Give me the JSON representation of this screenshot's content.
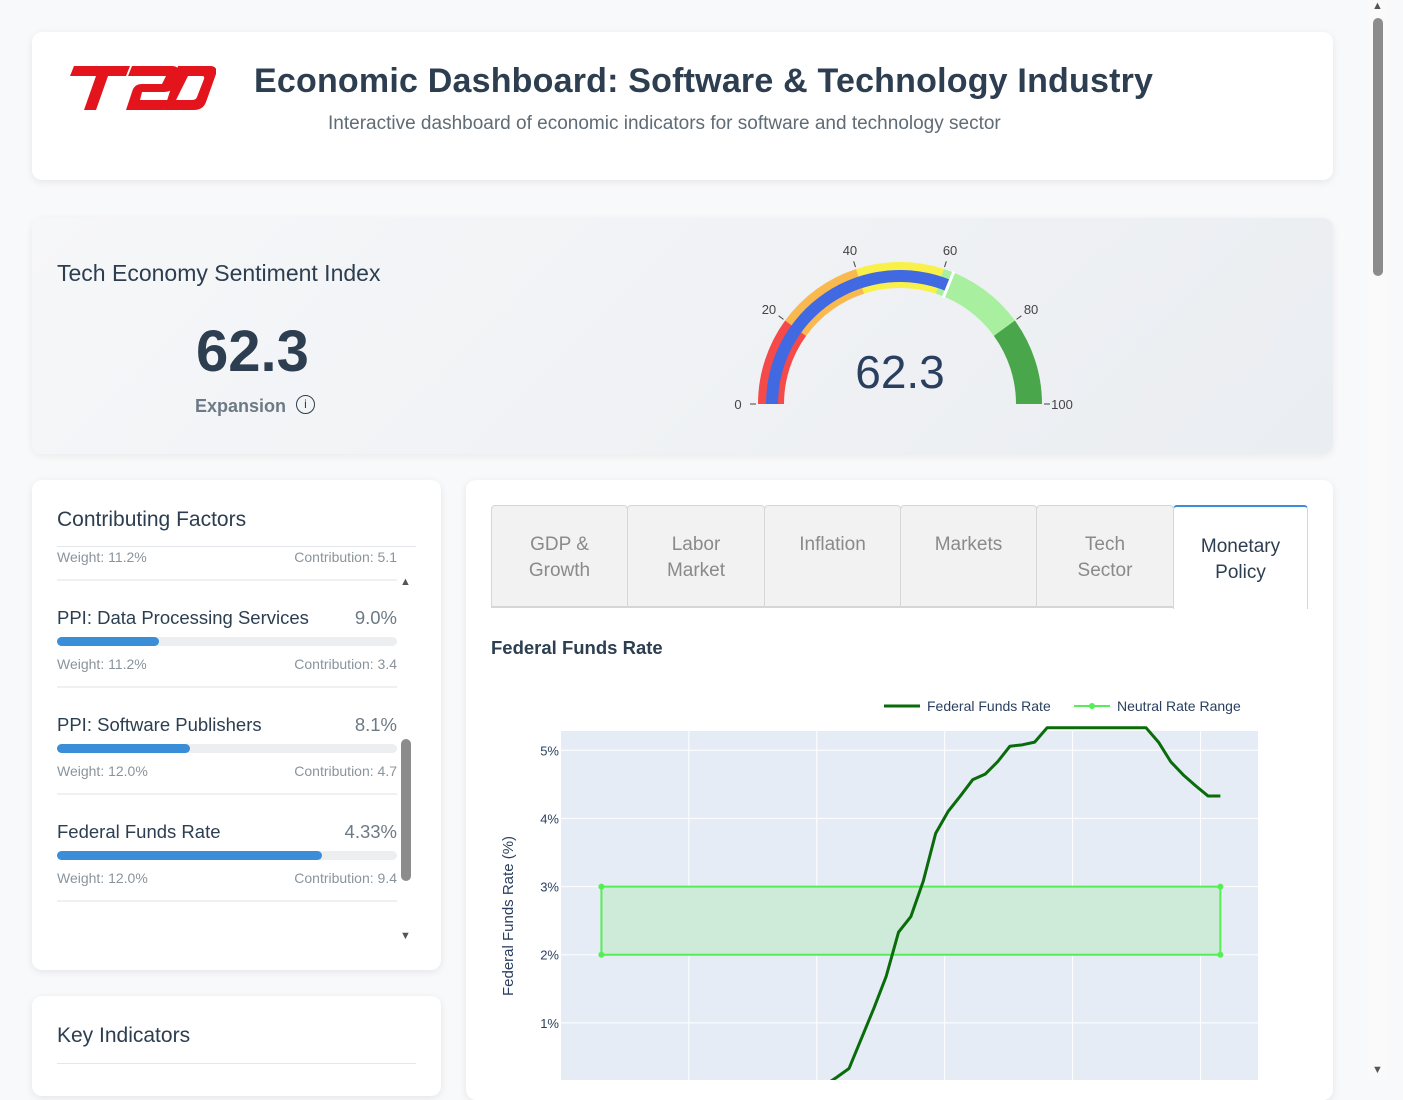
{
  "header": {
    "logo_text": "T2D",
    "title": "Economic Dashboard: Software & Technology Industry",
    "subtitle": "Interactive dashboard of economic indicators for software and technology sector"
  },
  "sentiment": {
    "title": "Tech Economy Sentiment Index",
    "value": "62.3",
    "label": "Expansion",
    "info_icon": "info-icon",
    "gauge": {
      "value": 62.3,
      "value_text": "62.3",
      "min": 0,
      "max": 100,
      "ticks": [
        "0",
        "20",
        "40",
        "60",
        "80",
        "100"
      ],
      "colors": {
        "band_0_20": "#f44a4a",
        "band_20_40": "#f9b94f",
        "band_40_60": "#f9f04a",
        "band_60_80": "#a8f0a0",
        "band_80_100": "#4aa64a",
        "value_bar": "#4169e1"
      }
    }
  },
  "factors": {
    "title": "Contributing Factors",
    "items": [
      {
        "name": "",
        "value": "",
        "weight": "Weight: 11.2%",
        "contribution": "Contribution: 5.1",
        "fill": 0
      },
      {
        "name": "PPI: Data Processing Services",
        "value": "9.0%",
        "weight": "Weight: 11.2%",
        "contribution": "Contribution: 3.4",
        "fill": 0.3
      },
      {
        "name": "PPI: Software Publishers",
        "value": "8.1%",
        "weight": "Weight: 12.0%",
        "contribution": "Contribution: 4.7",
        "fill": 0.39
      },
      {
        "name": "Federal Funds Rate",
        "value": "4.33%",
        "weight": "Weight: 12.0%",
        "contribution": "Contribution: 9.4",
        "fill": 0.78
      }
    ]
  },
  "key_indicators": {
    "title": "Key Indicators"
  },
  "tabs": [
    {
      "label": "GDP & Growth"
    },
    {
      "label": "Labor Market"
    },
    {
      "label": "Inflation"
    },
    {
      "label": "Markets"
    },
    {
      "label": "Tech Sector"
    },
    {
      "label": "Monetary Policy"
    }
  ],
  "chart_title": "Federal Funds Rate",
  "chart_data": {
    "type": "line",
    "title": "",
    "xlabel": "",
    "ylabel": "Federal Funds Rate (%)",
    "ylim": [
      0.0,
      5.6
    ],
    "y_ticks": [
      "1%",
      "2%",
      "3%",
      "4%",
      "5%"
    ],
    "grid": true,
    "legend_position": "top-right",
    "series": [
      {
        "name": "Federal Funds Rate",
        "color": "#0a6b0a",
        "x": [
          0,
          1,
          2,
          3,
          4,
          5,
          6,
          7,
          8,
          9,
          10,
          11,
          12,
          13,
          14,
          15,
          16,
          17,
          18,
          19,
          20,
          21,
          22,
          23,
          24,
          25,
          26,
          27,
          28,
          29,
          30,
          31,
          32,
          33,
          34,
          35,
          36,
          37,
          38,
          39,
          40,
          41,
          42,
          43,
          44,
          45,
          46,
          47,
          48,
          49,
          50
        ],
        "y": [
          0.08,
          0.08,
          0.08,
          0.08,
          0.08,
          0.08,
          0.08,
          0.08,
          0.08,
          0.08,
          0.08,
          0.08,
          0.08,
          0.08,
          0.08,
          0.08,
          0.08,
          0.08,
          0.08,
          0.2,
          0.33,
          0.77,
          1.21,
          1.68,
          2.33,
          2.56,
          3.08,
          3.78,
          4.1,
          4.33,
          4.57,
          4.65,
          4.83,
          5.06,
          5.08,
          5.12,
          5.33,
          5.33,
          5.33,
          5.33,
          5.33,
          5.33,
          5.33,
          5.33,
          5.33,
          5.12,
          4.83,
          4.64,
          4.48,
          4.33,
          4.33
        ]
      },
      {
        "name": "Neutral Rate Range",
        "color": "#55ee55",
        "fill_color": "#cdebd8",
        "x_start": 0,
        "x_end": 50,
        "lower": 2.0,
        "upper": 3.0
      }
    ]
  }
}
